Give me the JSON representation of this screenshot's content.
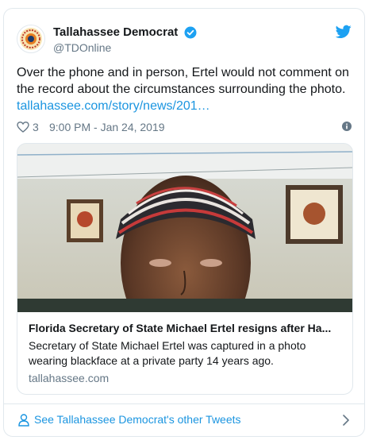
{
  "account": {
    "display_name": "Tallahassee Democrat",
    "handle": "@TDOnline"
  },
  "tweet": {
    "text": "Over the phone and in person, Ertel would not comment on the record about the circumstances surrounding the photo.",
    "link": "tallahassee.com/story/news/201…",
    "likes": "3",
    "timestamp": "9:00 PM - Jan 24, 2019"
  },
  "card": {
    "title": "Florida Secretary of State Michael Ertel resigns after Ha...",
    "description": "Secretary of State Michael Ertel was captured in a photo wearing blackface at a private party 14 years ago.",
    "domain": "tallahassee.com"
  },
  "footer": {
    "more_tweets_label": "See Tallahassee Democrat's other Tweets"
  },
  "colors": {
    "link": "#1b95e0",
    "muted": "#657786",
    "border": "#e1e8ed",
    "verified": "#1da1f2"
  },
  "icons": [
    "newspaper-logo-icon",
    "verified-badge-icon",
    "twitter-bird-icon",
    "heart-icon",
    "info-icon",
    "person-icon",
    "chevron-right-icon"
  ]
}
